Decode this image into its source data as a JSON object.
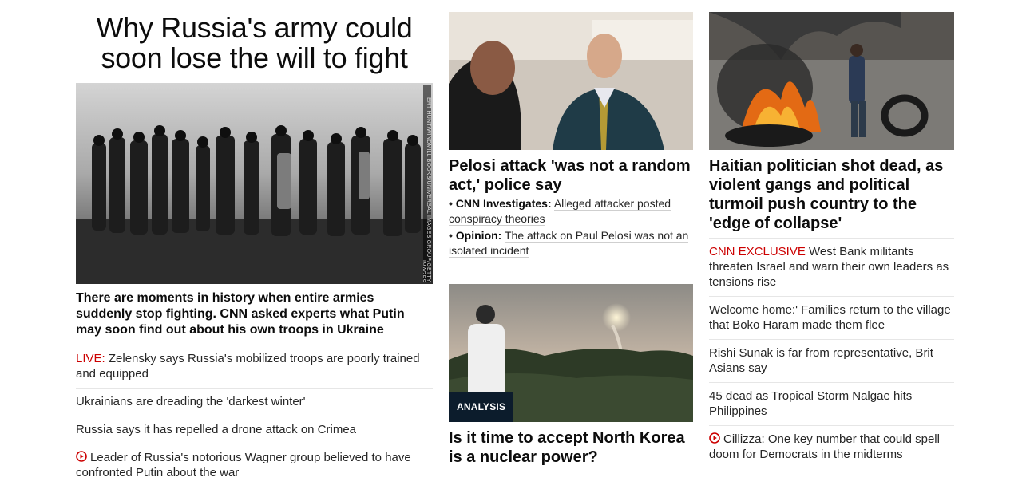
{
  "left": {
    "title": "Why Russia's army could soon lose the will to fight",
    "photo_credit": "ERT HUNT/WINDMILL BOOKS/UNIVERSAL IMAGES GROUP/GETTY IMAGES",
    "description": "There are moments in history when entire armies suddenly stop fighting. CNN asked experts what Putin may soon find out about his own troops in Ukraine",
    "items": [
      {
        "prefix": "LIVE:",
        "text": " Zelensky says Russia's mobilized troops are poorly trained and equipped"
      },
      {
        "text": "Ukrainians are dreading the 'darkest winter'"
      },
      {
        "text": "Russia says it has repelled a drone attack on Crimea"
      },
      {
        "text": "Leader of Russia's notorious Wagner group believed to have confronted Putin about the war",
        "icon": "play-circle-icon"
      }
    ]
  },
  "middle": {
    "story1": {
      "headline": "Pelosi attack 'was not a random act,' police say",
      "bullets": [
        {
          "tag": "CNN Investigates:",
          "text": "Alleged attacker posted conspiracy theories"
        },
        {
          "tag": "Opinion:",
          "text": "The attack on Paul Pelosi was not an isolated incident"
        }
      ]
    },
    "story2": {
      "badge": "ANALYSIS",
      "headline": "Is it time to accept North Korea is a nuclear power?"
    }
  },
  "right": {
    "headline": "Haitian politician shot dead, as violent gangs and political turmoil push country to the 'edge of collapse'",
    "items": [
      {
        "prefix": "CNN EXCLUSIVE",
        "text": " West Bank militants threaten Israel and warn their own leaders as tensions rise"
      },
      {
        "text": "Welcome home:' Families return to the village that Boko Haram made them flee"
      },
      {
        "text": "Rishi Sunak is far from representative, Brit Asians say"
      },
      {
        "text": "45 dead as Tropical Storm Nalgae hits Philippines"
      },
      {
        "text": "Cillizza: One key number that could spell doom for Democrats in the midterms",
        "icon": "play-circle-icon"
      }
    ]
  },
  "colors": {
    "accent_red": "#cc0000",
    "badge_bg": "#0c1c2c",
    "divider": "#e6e6e6"
  }
}
